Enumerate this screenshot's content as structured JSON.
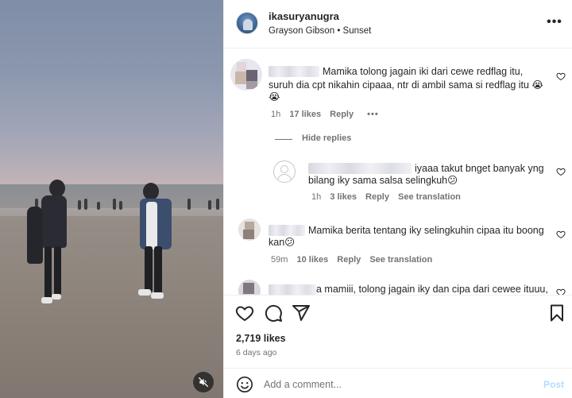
{
  "post": {
    "username": "ikasuryanugra",
    "music_artist": "Grayson Gibson",
    "separator": "•",
    "music_title": "Sunset",
    "more_label": "•••"
  },
  "comments": [
    {
      "text": "Mamika tolong jagain iki dari cewe redflag itu, suruh dia cpt nikahin cipaaa, ntr di ambil sama si redflag itu 😭 😭",
      "line1": "Mamika tolong jagain iki dari cewe redflag itu,",
      "line2": "suruh dia cpt nikahin cipaaa, ntr di ambil sama si redflag itu 😭",
      "line3": "😭",
      "time": "1h",
      "likes": "17 likes",
      "reply": "Reply",
      "options": "•••"
    },
    {
      "hide_replies": "Hide replies",
      "is_reply": true,
      "line1": "iyaaa takut bnget banyak yng",
      "line2": "bilang iky sama salsa selingkuh😕",
      "time": "1h",
      "likes": "3 likes",
      "reply": "Reply",
      "see_translation": "See translation"
    },
    {
      "line1": "Mamika berita tentang iky selingkuhin cipaa itu boong",
      "line2": "kan😕",
      "time": "59m",
      "likes": "10 likes",
      "reply": "Reply",
      "see_translation": "See translation"
    },
    {
      "line1": "a mamiii, tolong jagain iky dan cipa dari cewee ituuu,"
    }
  ],
  "footer": {
    "likes": "2,719 likes",
    "posted_ago": "6 days ago",
    "comment_placeholder": "Add a comment...",
    "post_label": "Post"
  },
  "icons": {
    "heart": "heart-icon",
    "comment": "comment-icon",
    "share": "share-icon",
    "save": "bookmark-icon",
    "emoji": "emoji-icon",
    "mute": "muted-speaker-icon"
  },
  "colors": {
    "text": "#262626",
    "secondary": "#737373",
    "post_disabled": "#b3dbff",
    "divider": "#efefef"
  }
}
